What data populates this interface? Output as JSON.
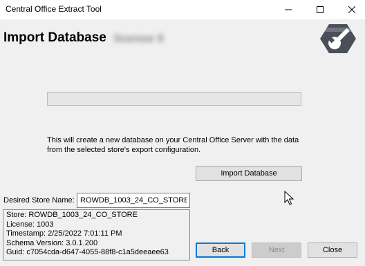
{
  "window": {
    "title": "Central Office Extract Tool"
  },
  "header": {
    "title": "Import Database",
    "license_blurred": "license 0"
  },
  "logo": {
    "icon": "wrench-gear-icon"
  },
  "progress": {
    "value": 0
  },
  "description": "This will create a new database on your Central Office Server with the data from the selected store's export configuration.",
  "actions": {
    "import_label": "Import Database"
  },
  "store": {
    "label": "Desired Store Name:",
    "value": "ROWDB_1003_24_CO_STORE"
  },
  "details": [
    "Store: ROWDB_1003_24_CO_STORE",
    "License: 1003",
    "Timestamp: 2/25/2022 7:01:11 PM",
    "Schema Version: 3.0.1.200",
    "Guid: c7054cda-d647-4055-88f8-c1a5deeaee63"
  ],
  "nav": {
    "back_label": "Back",
    "next_label": "Next",
    "close_label": "Close"
  },
  "colors": {
    "focus_border": "#0078d7",
    "window_bg": "#f0f0f0",
    "logo_dark": "#4a4f59"
  }
}
